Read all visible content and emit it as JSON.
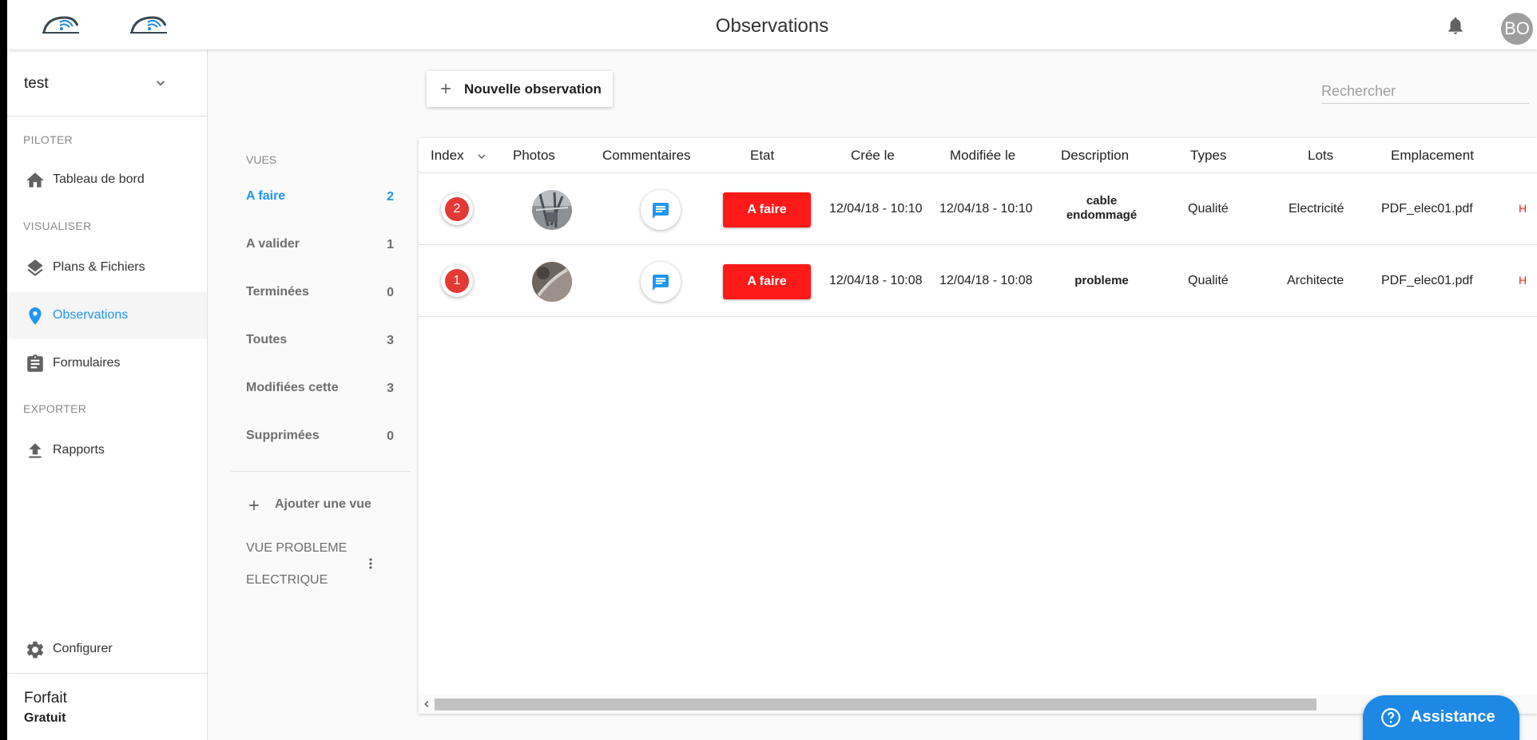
{
  "header": {
    "title": "Observations",
    "avatar_initials": "BO"
  },
  "sidebar": {
    "project_name": "test",
    "sections": {
      "piloter": "PILOTER",
      "visualiser": "VISUALISER",
      "exporter": "EXPORTER"
    },
    "items": {
      "dashboard": "Tableau de bord",
      "plans": "Plans & Fichiers",
      "observations": "Observations",
      "forms": "Formulaires",
      "reports": "Rapports",
      "configure": "Configurer"
    },
    "active_item": "Observations",
    "plan": {
      "label": "Forfait",
      "value": "Gratuit"
    }
  },
  "toolbar": {
    "new_observation": "Nouvelle observation",
    "search_placeholder": "Rechercher"
  },
  "views": {
    "title": "VUES",
    "items": [
      {
        "label": "A faire",
        "count": "2"
      },
      {
        "label": "A valider",
        "count": "1"
      },
      {
        "label": "Terminées",
        "count": "0"
      },
      {
        "label": "Toutes",
        "count": "3"
      },
      {
        "label": "Modifiées cette",
        "count": "3"
      },
      {
        "label": "Supprimées",
        "count": "0"
      }
    ],
    "active_view": "A faire",
    "add_view": "Ajouter une vue",
    "custom_view_line1": "VUE PROBLEME",
    "custom_view_line2": "ELECTRIQUE"
  },
  "table": {
    "columns": {
      "index": "Index",
      "photos": "Photos",
      "comments": "Commentaires",
      "state": "Etat",
      "created": "Crée le",
      "modified": "Modifiée le",
      "description": "Description",
      "types": "Types",
      "lots": "Lots",
      "location": "Emplacement"
    },
    "rows": [
      {
        "index": "2",
        "state": "A faire",
        "created": "12/04/18 - 10:10",
        "modified": "12/04/18 - 10:10",
        "description_line1": "cable",
        "description_line2": "endommagé",
        "type": "Qualité",
        "lot": "Electricité",
        "location": "PDF_elec01.pdf",
        "overflow": "H"
      },
      {
        "index": "1",
        "state": "A faire",
        "created": "12/04/18 - 10:08",
        "modified": "12/04/18 - 10:08",
        "description_line1": "probleme",
        "description_line2": "",
        "type": "Qualité",
        "lot": "Architecte",
        "location": "PDF_elec01.pdf",
        "overflow": "H"
      }
    ]
  },
  "assistance": {
    "label": "Assistance"
  },
  "colors": {
    "accent": "#2196f3",
    "danger": "#ff1a1a",
    "badge": "#e53935",
    "assistance": "#1e88e5"
  }
}
